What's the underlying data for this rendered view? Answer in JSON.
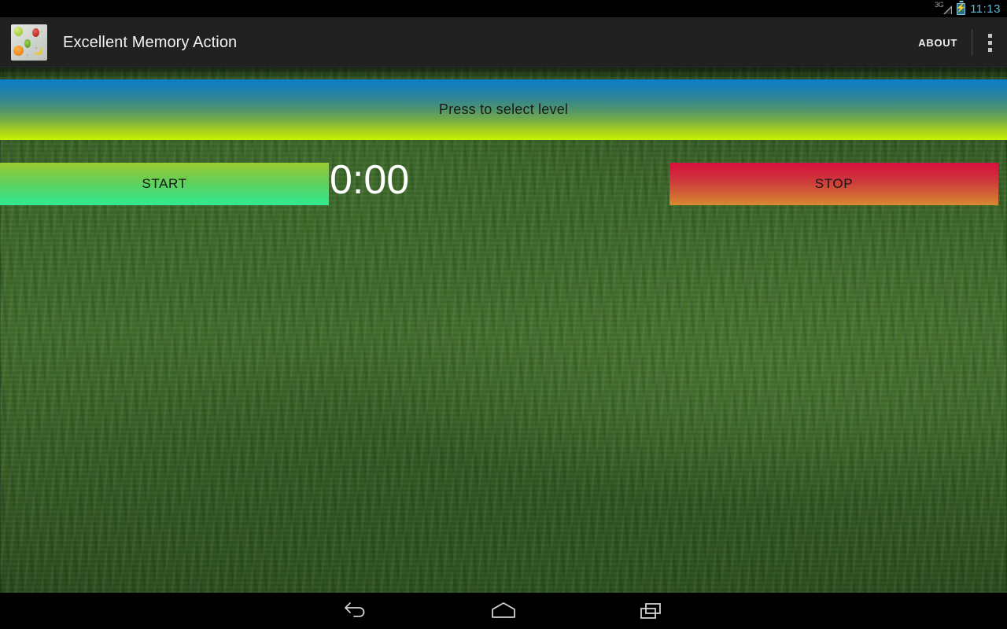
{
  "status_bar": {
    "network_label": "3G",
    "signal_icon": "signal-bars-icon",
    "battery_icon": "battery-charging-icon",
    "clock": "11:13"
  },
  "action_bar": {
    "app_icon": "app-fruit-icon",
    "title": "Excellent Memory Action",
    "about_label": "ABOUT",
    "overflow_icon": "overflow-menu-icon"
  },
  "main": {
    "level_banner_label": "Press to select level",
    "start_label": "START",
    "stop_label": "STOP",
    "timer_value": "0:00"
  },
  "nav_bar": {
    "back_icon": "back-arrow-icon",
    "home_icon": "home-icon",
    "recents_icon": "recent-apps-icon"
  },
  "colors": {
    "status_bar_bg": "#000000",
    "action_bar_bg": "#212121",
    "clock_text": "#66b8d8",
    "banner_top": "#0d7cc9",
    "banner_bottom": "#c9f103",
    "start_top": "#9ccb2e",
    "start_bottom": "#2eeb92",
    "stop_top": "#d90d3e",
    "stop_bottom": "#d98a31",
    "timer_text": "#ffffff",
    "grass_bg": "#3c6729"
  }
}
